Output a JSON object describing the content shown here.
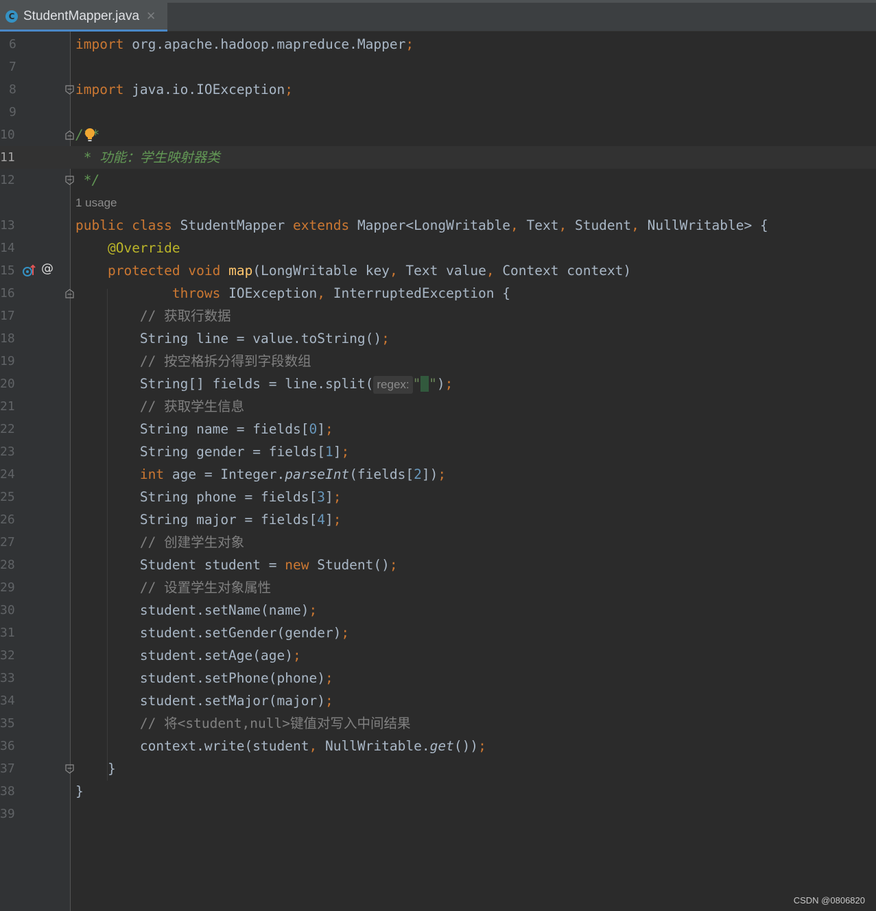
{
  "tab": {
    "file_name": "StudentMapper.java",
    "file_icon": "C",
    "close": "✕"
  },
  "gutter": {
    "line_numbers": [
      "6",
      "7",
      "8",
      "9",
      "10",
      "11",
      "12",
      "13",
      "14",
      "15",
      "16",
      "17",
      "18",
      "19",
      "20",
      "21",
      "22",
      "23",
      "24",
      "25",
      "26",
      "27",
      "28",
      "29",
      "30",
      "31",
      "32",
      "33",
      "34",
      "35",
      "36",
      "37",
      "38",
      "39"
    ]
  },
  "code": {
    "l6": {
      "kw": "import",
      "rest": " org.apache.hadoop.mapreduce.Mapper",
      "semi": ";"
    },
    "l8": {
      "kw": "import",
      "rest": " java.io.IOException",
      "semi": ";"
    },
    "l10": {
      "doc": "/**"
    },
    "l11": {
      "doc": " * 功能：学生映射器类"
    },
    "l12": {
      "doc": " */"
    },
    "usage": "1 usage",
    "l13": {
      "public": "public",
      "class": "class",
      "name": " StudentMapper ",
      "extends": "extends",
      "mapper": " Mapper<LongWritable",
      "c1": ",",
      "t1": " Text",
      "c2": ",",
      "t2": " Student",
      "c3": ",",
      "t3": " NullWritable> {"
    },
    "l14": {
      "ann": "@Override"
    },
    "l15": {
      "protected": "protected",
      "void": "void",
      "map": "map",
      "p1": "(LongWritable key",
      "c1": ",",
      "p2": " Text value",
      "c2": ",",
      "p3": " Context context)"
    },
    "l16": {
      "throws": "throws",
      "e1": " IOException",
      "c1": ",",
      "e2": " InterruptedException {"
    },
    "l17": {
      "cmt": "// 获取行数据"
    },
    "l18": {
      "a": "String line = value.toString()",
      "semi": ";"
    },
    "l19": {
      "cmt": "// 按空格拆分得到字段数组"
    },
    "l20": {
      "a": "String[] fields = line.split(",
      "hint": "regex:",
      "q1": "\"",
      "sp": " ",
      "q2": "\"",
      "b": ")",
      "semi": ";"
    },
    "l21": {
      "cmt": "// 获取学生信息"
    },
    "l22": {
      "a": "String name = fields[",
      "n": "0",
      "b": "]",
      "semi": ";"
    },
    "l23": {
      "a": "String gender = fields[",
      "n": "1",
      "b": "]",
      "semi": ";"
    },
    "l24": {
      "kw": "int",
      "a": " age = Integer.",
      "it": "parseInt",
      "b": "(fields[",
      "n": "2",
      "c": "])",
      "semi": ";"
    },
    "l25": {
      "a": "String phone = fields[",
      "n": "3",
      "b": "]",
      "semi": ";"
    },
    "l26": {
      "a": "String major = fields[",
      "n": "4",
      "b": "]",
      "semi": ";"
    },
    "l27": {
      "cmt": "// 创建学生对象"
    },
    "l28": {
      "a": "Student student = ",
      "kw": "new",
      "b": " Student()",
      "semi": ";"
    },
    "l29": {
      "cmt": "// 设置学生对象属性"
    },
    "l30": {
      "a": "student.setName(name)",
      "semi": ";"
    },
    "l31": {
      "a": "student.setGender(gender)",
      "semi": ";"
    },
    "l32": {
      "a": "student.setAge(age)",
      "semi": ";"
    },
    "l33": {
      "a": "student.setPhone(phone)",
      "semi": ";"
    },
    "l34": {
      "a": "student.setMajor(major)",
      "semi": ";"
    },
    "l35": {
      "cmt": "// 将<student,null>键值对写入中间结果"
    },
    "l36": {
      "a": "context.write(student",
      "c": ",",
      "b": " NullWritable.",
      "it": "get",
      "d": "())",
      "semi": ";"
    },
    "l37": {
      "a": "}"
    },
    "l38": {
      "a": "}"
    }
  },
  "gutter_icons": {
    "implements": "implements-method-icon",
    "override": "@"
  },
  "watermark": "CSDN @0806820",
  "colors": {
    "background": "#2b2b2b",
    "keyword": "#cc7832",
    "annotation": "#bbb529",
    "method": "#ffc66d",
    "number": "#6897bb",
    "string": "#6a8759",
    "comment": "#808080",
    "doc": "#629755"
  }
}
